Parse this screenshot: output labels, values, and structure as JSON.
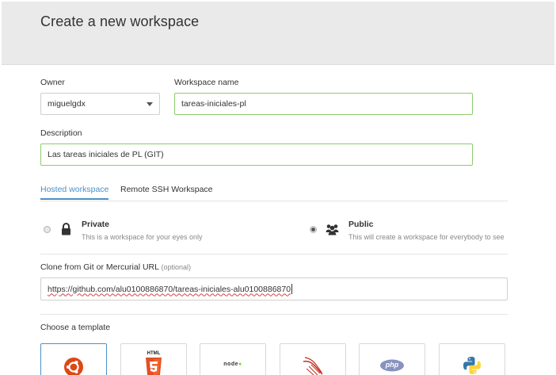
{
  "header": {
    "title": "Create a new workspace"
  },
  "form": {
    "owner_label": "Owner",
    "owner_value": "miguelgdx",
    "workspace_name_label": "Workspace name",
    "workspace_name_value": "tareas-iniciales-pl",
    "description_label": "Description",
    "description_value": "Las tareas iniciales de PL (GIT)"
  },
  "tabs": [
    {
      "label": "Hosted workspace",
      "active": true
    },
    {
      "label": "Remote SSH Workspace",
      "active": false
    }
  ],
  "visibility": {
    "private": {
      "title": "Private",
      "desc": "This is a workspace for your eyes only",
      "icon": "lock-icon",
      "selected": false
    },
    "public": {
      "title": "Public",
      "desc": "This will create a workspace for everybody to see",
      "icon": "people-icon",
      "selected": true
    }
  },
  "clone": {
    "label": "Clone from Git or Mercurial URL",
    "optional": "(optional)",
    "value": "https://github.com/alu0100886870/tareas-iniciales-alu0100886870"
  },
  "templates": {
    "label": "Choose a template",
    "items": [
      {
        "name": "ubuntu-icon",
        "selected": true
      },
      {
        "name": "html5-icon",
        "text": "HTML",
        "selected": false
      },
      {
        "name": "nodejs-icon",
        "text": "node",
        "selected": false
      },
      {
        "name": "rails-icon",
        "selected": false
      },
      {
        "name": "php-icon",
        "text": "php",
        "selected": false
      },
      {
        "name": "python-icon",
        "selected": false
      }
    ]
  },
  "colors": {
    "accent": "#4a90c8",
    "valid_border": "#8dcb6c",
    "header_bg": "#eaeaea"
  }
}
